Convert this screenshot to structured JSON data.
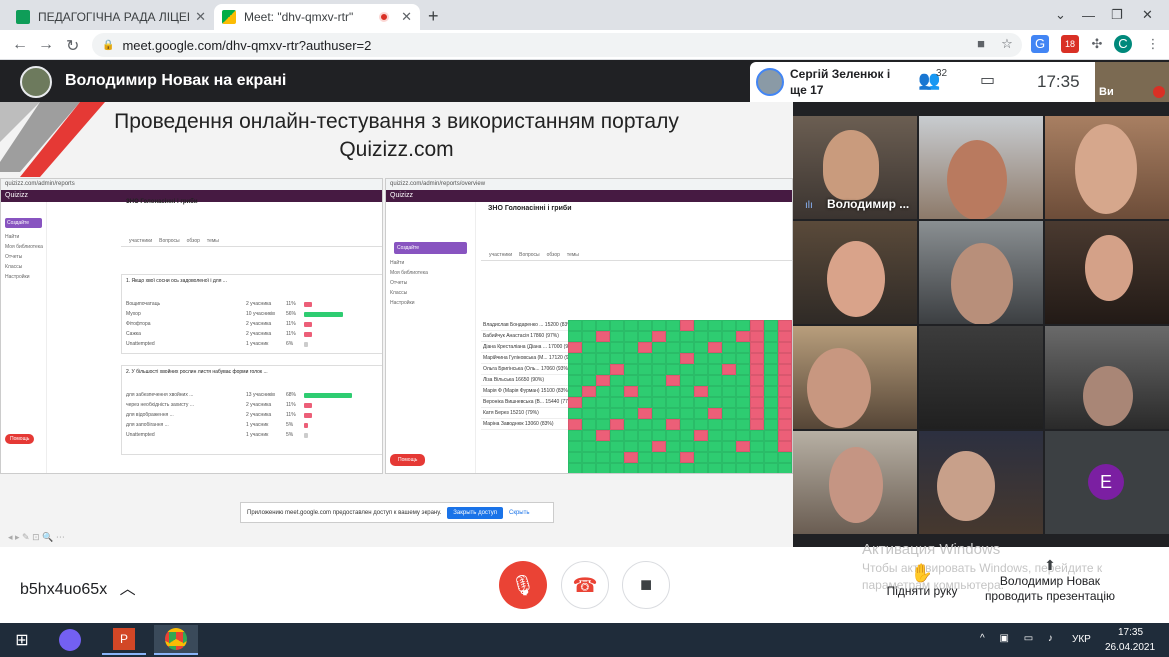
{
  "browser": {
    "tabs": [
      {
        "title": "ПЕДАГОГІЧНА РАДА ЛІЦЕЮ-ІНТ",
        "icon": "google-slides-icon",
        "color": "#0f9d58"
      },
      {
        "title": "Meet: \"dhv-qmxv-rtr\"",
        "icon": "google-meet-icon",
        "color": "#00897b"
      }
    ],
    "url": "meet.google.com/dhv-qmxv-rtr?authuser=2",
    "profile_initial": "С",
    "badge": "18"
  },
  "meet": {
    "presenter_banner": "Володимир Новак на екрані",
    "participants_label": "Сергій Зеленюк і ще 17",
    "people_count": "32",
    "time": "17:35",
    "self_label": "Ви",
    "meeting_code": "b5hx4uo65x",
    "raise_hand": "Підняти руку",
    "presenting_label": "Володимир Новак проводить презентацію",
    "tile_names": [
      "Володимир ..."
    ],
    "tile_letter": "Е",
    "share_notice": {
      "text": "Приложению meet.google.com предоставлен доступ к вашему экрану.",
      "stop": "Закрыть доступ",
      "hide": "Скрыть"
    }
  },
  "slide": {
    "title_line1": "Проведення онлайн-тестування з використанням порталу",
    "title_line2": "Quizizz.com",
    "quiz_title": "ЗНО Голонасінні і гриби",
    "left": {
      "q1": "1. Якщо хвої сосни ось задоволеної і для ...",
      "answers1": [
        {
          "label": "Вощипочатаць",
          "count": "2 учасника",
          "pct": "11%",
          "value": 11,
          "ok": false
        },
        {
          "label": "Мухор",
          "count": "10 учасників",
          "pct": "56%",
          "value": 56,
          "ok": true
        },
        {
          "label": "Фітофтора",
          "count": "2 учасника",
          "pct": "11%",
          "value": 11,
          "ok": false
        },
        {
          "label": "Сажка",
          "count": "2 учасника",
          "pct": "11%",
          "value": 11,
          "ok": false
        },
        {
          "label": "Unattempted",
          "count": "1 учасник",
          "pct": "6%",
          "value": 6,
          "ok": null
        }
      ],
      "q2": "2. У більшості хвойних рослин листя набуває форми голок ...",
      "answers2": [
        {
          "label": "для забезпечення хвойних ...",
          "count": "13 учасників",
          "pct": "68%",
          "value": 68,
          "ok": true
        },
        {
          "label": "через необхідність захисту ...",
          "count": "2 учасника",
          "pct": "11%",
          "value": 11,
          "ok": false
        },
        {
          "label": "для відображення ...",
          "count": "2 учасника",
          "pct": "11%",
          "value": 11,
          "ok": false
        },
        {
          "label": "для запобігання ...",
          "count": "1 учасник",
          "pct": "5%",
          "value": 5,
          "ok": false
        },
        {
          "label": "Unattempted",
          "count": "1 учасник",
          "pct": "5%",
          "value": 5,
          "ok": null
        }
      ]
    },
    "right": {
      "students": [
        "Владислав Бондаренко ...",
        "Бабийчук Анастасія",
        "Діана Кресталіана (Діана ...",
        "Марійчина Гуліновська (М...",
        "Ольга Бригінська (Оль...",
        "Ліза Вільська",
        "Марія Ф (Марія Фурман)",
        "Вероніка Вишневська (В...",
        "Катя Берез",
        "Маріна Заводнюк"
      ],
      "scores": [
        "15200 (83%)",
        "17860 (97%)",
        "17000 (93%)",
        "17120 (97%)",
        "17060 (93%)",
        "16650 (90%)",
        "15100 (83%)",
        "15440 (77%)",
        "15210 (79%)",
        "13060 (83%)"
      ]
    }
  },
  "watermark": {
    "line1": "Активация Windows",
    "line2": "Чтобы активировать Windows, перейдите к",
    "line3": "параметрам компьютера."
  },
  "taskbar": {
    "time": "17:35",
    "date": "26.04.2021",
    "lang": "УКР"
  }
}
